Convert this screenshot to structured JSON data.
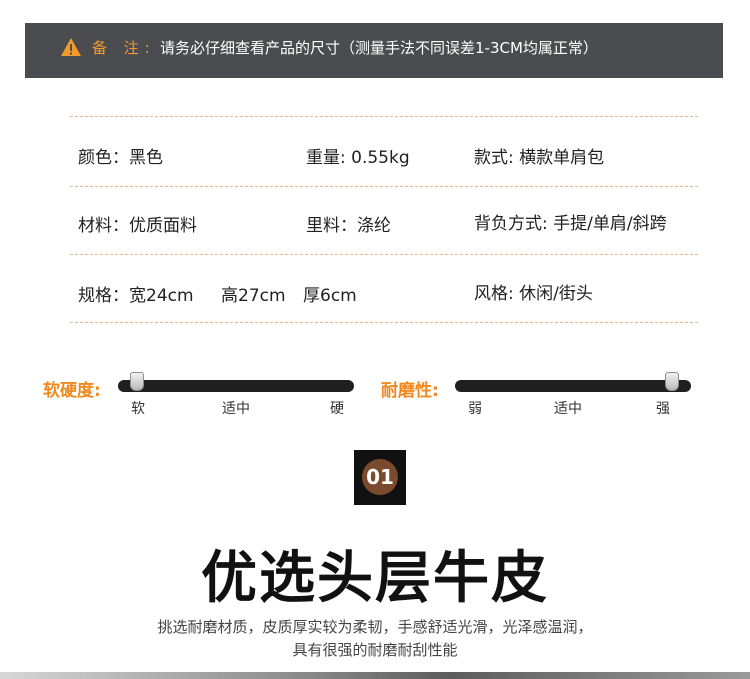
{
  "notice": {
    "label": "备 注:",
    "text": "请务必仔细查看产品的尺寸（测量手法不同误差1-3CM均属正常）"
  },
  "specs": {
    "color": "颜色：黑色",
    "weight": "重量: 0.55kg",
    "style": "款式: 横款单肩包",
    "material": "材料：优质面料",
    "lining": "里料：涤纶",
    "carry": "背负方式: 手提/单肩/斜跨",
    "size_label": "规格：宽24cm",
    "size_height": "高27cm",
    "size_thickness": "厚6cm",
    "vibe": "风格: 休闲/街头"
  },
  "sliders": [
    {
      "label": "软硬度:",
      "ticks": [
        "软",
        "适中",
        "硬"
      ],
      "level": 0.08
    },
    {
      "label": "耐磨性:",
      "ticks": [
        "弱",
        "适中",
        "强"
      ],
      "level": 0.92
    }
  ],
  "section": {
    "number": "01",
    "title": "优选头层牛皮",
    "desc_line1": "挑选耐磨材质，皮质厚实较为柔韧，手感舒适光滑，光泽感温润，",
    "desc_line2": "具有很强的耐磨耐刮性能"
  },
  "colors": {
    "accent": "#f08a1e",
    "notice_bg": "#4a4c4f",
    "badge_circle": "#7a4a2c"
  }
}
